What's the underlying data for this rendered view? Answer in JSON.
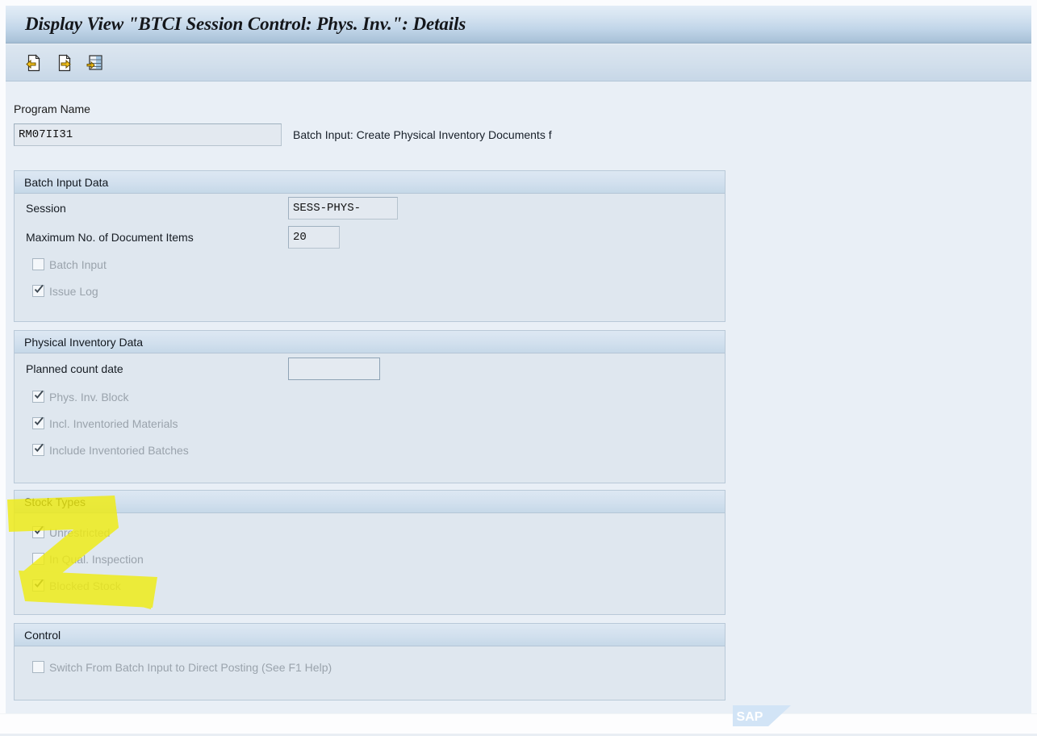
{
  "window": {
    "title": "Display View \"BTCI Session Control: Phys. Inv.\": Details"
  },
  "toolbar": {
    "buttons": [
      {
        "name": "previous-entry",
        "icon": "document-left-arrow-icon",
        "tooltip": "Previous Entry"
      },
      {
        "name": "next-entry",
        "icon": "document-right-arrow-icon",
        "tooltip": "Next Entry"
      },
      {
        "name": "details",
        "icon": "table-right-arrow-icon",
        "tooltip": "Details"
      }
    ]
  },
  "program": {
    "label": "Program Name",
    "value": "RM07II31",
    "description": "Batch Input: Create Physical Inventory Documents f"
  },
  "groups": [
    {
      "title": "Batch Input Data",
      "fields": [
        {
          "label": "Session",
          "value": "SESS-PHYS-",
          "kind": "text",
          "width": "sess"
        },
        {
          "label": "Maximum No. of Document Items",
          "value": "20",
          "kind": "text",
          "width": "max"
        }
      ],
      "checkboxes": [
        {
          "label": "Batch Input",
          "checked": false,
          "disabled": true
        },
        {
          "label": "Issue Log",
          "checked": true,
          "disabled": true
        }
      ]
    },
    {
      "title": "Physical Inventory Data",
      "fields": [
        {
          "label": "Planned count date",
          "value": "",
          "kind": "date",
          "width": "date"
        }
      ],
      "checkboxes": [
        {
          "label": "Phys. Inv. Block",
          "checked": true,
          "disabled": true
        },
        {
          "label": "Incl. Inventoried Materials",
          "checked": true,
          "disabled": true
        },
        {
          "label": "Include Inventoried Batches",
          "checked": true,
          "disabled": true
        }
      ]
    },
    {
      "title": "Stock Types",
      "fields": [],
      "checkboxes": [
        {
          "label": "Unrestricted",
          "checked": true,
          "disabled": true
        },
        {
          "label": "In Qual. Inspection",
          "checked": false,
          "disabled": true
        },
        {
          "label": "Blocked Stock",
          "checked": true,
          "disabled": true
        }
      ]
    },
    {
      "title": "Control",
      "fields": [],
      "checkboxes": [
        {
          "label": "Switch From Batch Input to Direct Posting (See F1 Help)",
          "checked": false,
          "disabled": true
        }
      ]
    }
  ],
  "annotation": {
    "shape": "z-mark",
    "color": "#f0ec12",
    "target": "Stock Types"
  },
  "branding": {
    "logo_text": "SAP",
    "logo_color": "#cfe2f5"
  },
  "colors": {
    "title_bar": "#c2d6e9",
    "toolbar": "#d2dfec",
    "canvas": "#e9eff6",
    "group_fill": "#dfe7ef",
    "group_header": "#d2e0ee",
    "group_border": "#b9c9d8",
    "highlighter": "#f0ec12",
    "disabled_text": "#9aa3ac"
  }
}
